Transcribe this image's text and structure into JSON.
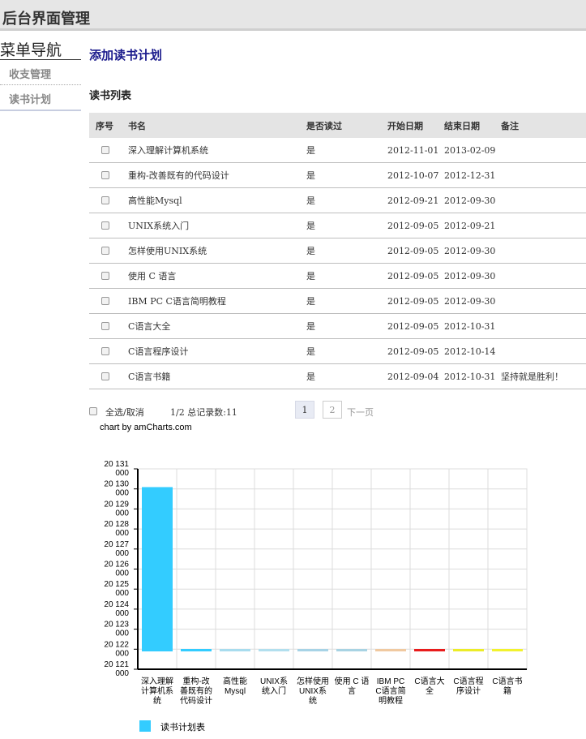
{
  "header": {
    "title": "后台界面管理"
  },
  "sidebar": {
    "title": "菜单导航",
    "items": [
      {
        "label": "收支管理"
      },
      {
        "label": "读书计划"
      }
    ]
  },
  "main": {
    "page_title": "添加读书计划",
    "section_title": "读书列表",
    "table": {
      "columns": [
        "序号",
        "书名",
        "是否读过",
        "开始日期",
        "结束日期",
        "备注"
      ],
      "rows": [
        {
          "name": "深入理解计算机系统",
          "read": "是",
          "start": "2012-11-01",
          "end": "2013-02-09",
          "note": ""
        },
        {
          "name": "重构-改善既有的代码设计",
          "read": "是",
          "start": "2012-10-07",
          "end": "2012-12-31",
          "note": ""
        },
        {
          "name": "高性能Mysql",
          "read": "是",
          "start": "2012-09-21",
          "end": "2012-09-30",
          "note": ""
        },
        {
          "name": "UNIX系统入门",
          "read": "是",
          "start": "2012-09-05",
          "end": "2012-09-21",
          "note": ""
        },
        {
          "name": "怎样使用UNIX系统",
          "read": "是",
          "start": "2012-09-05",
          "end": "2012-09-30",
          "note": ""
        },
        {
          "name": "使用 C 语言",
          "read": "是",
          "start": "2012-09-05",
          "end": "2012-09-30",
          "note": ""
        },
        {
          "name": "IBM PC C语言简明教程",
          "read": "是",
          "start": "2012-09-05",
          "end": "2012-09-30",
          "note": ""
        },
        {
          "name": "C语言大全",
          "read": "是",
          "start": "2012-09-05",
          "end": "2012-10-31",
          "note": ""
        },
        {
          "name": "C语言程序设计",
          "read": "是",
          "start": "2012-09-05",
          "end": "2012-10-14",
          "note": ""
        },
        {
          "name": "C语言书籍",
          "read": "是",
          "start": "2012-09-04",
          "end": "2012-10-31",
          "note": "坚持就是胜利！"
        }
      ]
    },
    "footer": {
      "select_all": "全选/取消",
      "page_info": "1/2 总记录数:11",
      "pages": [
        "1",
        "2"
      ],
      "next_label": "下一页"
    },
    "chart_credit": "chart by amCharts.com"
  },
  "chart_data": {
    "type": "bar",
    "categories": [
      "深入理解计算机系统",
      "重构-改善既有的代码设计",
      "高性能Mysql",
      "UNIX系统入门",
      "怎样使用UNIX系统",
      "使用 C 语言",
      "IBM PC C语言简明教程",
      "C语言大全",
      "C语言程序设计",
      "C语言书籍"
    ],
    "category_label_lines": [
      [
        "深入理解",
        "计算机系",
        "统"
      ],
      [
        "重构-改",
        "善既有的",
        "代码设计"
      ],
      [
        "高性能",
        "Mysql"
      ],
      [
        "UNIX系",
        "统入门"
      ],
      [
        "怎样使用",
        "UNIX系",
        "统"
      ],
      [
        "使用 C 语",
        "言"
      ],
      [
        "IBM PC",
        "C语言简",
        "明教程"
      ],
      [
        "C语言大",
        "全"
      ],
      [
        "C语言程",
        "序设计"
      ],
      [
        "C语言书",
        "籍"
      ]
    ],
    "series": [
      {
        "name": "读书计划表",
        "values": [
          20130090,
          20121231,
          20120930,
          20120921,
          20120930,
          20120930,
          20120930,
          20121031,
          20121014,
          20121031
        ]
      }
    ],
    "bar_colors": [
      "#33ccff",
      "#33ccff",
      "#a8dcee",
      "#b2dfee",
      "#a7d3e6",
      "#a8d3e3",
      "#f0c9a0",
      "#e81c1c",
      "#ecec28",
      "#f2f22e"
    ],
    "yticks": [
      [
        "20 121",
        "000"
      ],
      [
        "20 122",
        "000"
      ],
      [
        "20 123",
        "000"
      ],
      [
        "20 124",
        "000"
      ],
      [
        "20 125",
        "000"
      ],
      [
        "20 126",
        "000"
      ],
      [
        "20 127",
        "000"
      ],
      [
        "20 128",
        "000"
      ],
      [
        "20 129",
        "000"
      ],
      [
        "20 130",
        "000"
      ],
      [
        "20 131",
        "000"
      ]
    ],
    "ylim": [
      20121000,
      20131000
    ],
    "grid": true,
    "legend_position": "bottom-left",
    "legend_color": "#33ccff"
  }
}
